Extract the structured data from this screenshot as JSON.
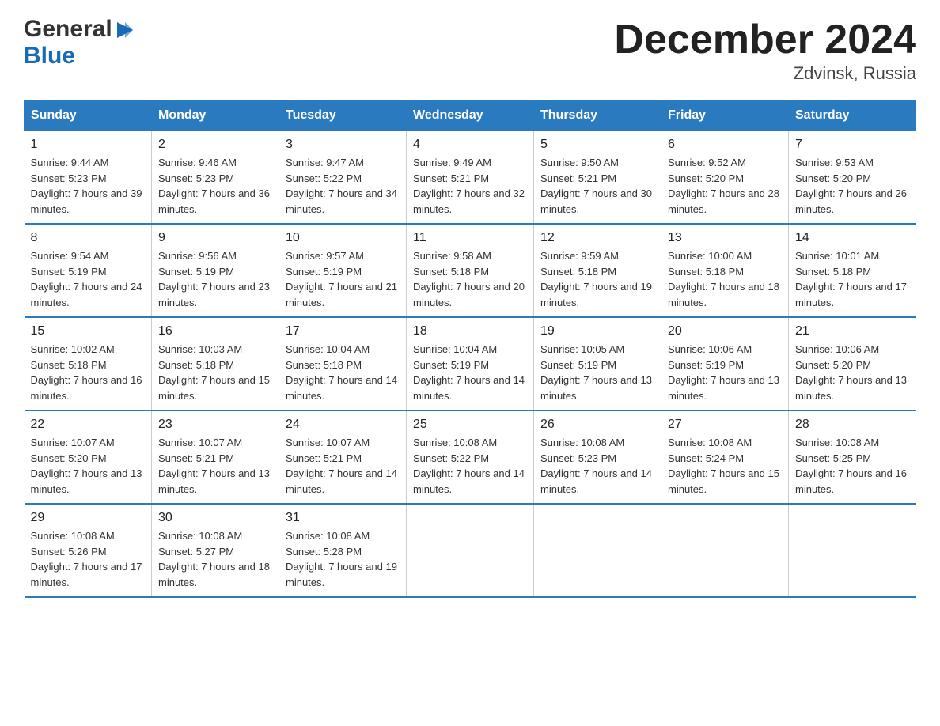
{
  "header": {
    "title": "December 2024",
    "subtitle": "Zdvinsk, Russia",
    "logo_general": "General",
    "logo_blue": "Blue"
  },
  "days_of_week": [
    "Sunday",
    "Monday",
    "Tuesday",
    "Wednesday",
    "Thursday",
    "Friday",
    "Saturday"
  ],
  "weeks": [
    [
      {
        "day": "1",
        "sunrise": "9:44 AM",
        "sunset": "5:23 PM",
        "daylight": "7 hours and 39 minutes."
      },
      {
        "day": "2",
        "sunrise": "9:46 AM",
        "sunset": "5:23 PM",
        "daylight": "7 hours and 36 minutes."
      },
      {
        "day": "3",
        "sunrise": "9:47 AM",
        "sunset": "5:22 PM",
        "daylight": "7 hours and 34 minutes."
      },
      {
        "day": "4",
        "sunrise": "9:49 AM",
        "sunset": "5:21 PM",
        "daylight": "7 hours and 32 minutes."
      },
      {
        "day": "5",
        "sunrise": "9:50 AM",
        "sunset": "5:21 PM",
        "daylight": "7 hours and 30 minutes."
      },
      {
        "day": "6",
        "sunrise": "9:52 AM",
        "sunset": "5:20 PM",
        "daylight": "7 hours and 28 minutes."
      },
      {
        "day": "7",
        "sunrise": "9:53 AM",
        "sunset": "5:20 PM",
        "daylight": "7 hours and 26 minutes."
      }
    ],
    [
      {
        "day": "8",
        "sunrise": "9:54 AM",
        "sunset": "5:19 PM",
        "daylight": "7 hours and 24 minutes."
      },
      {
        "day": "9",
        "sunrise": "9:56 AM",
        "sunset": "5:19 PM",
        "daylight": "7 hours and 23 minutes."
      },
      {
        "day": "10",
        "sunrise": "9:57 AM",
        "sunset": "5:19 PM",
        "daylight": "7 hours and 21 minutes."
      },
      {
        "day": "11",
        "sunrise": "9:58 AM",
        "sunset": "5:18 PM",
        "daylight": "7 hours and 20 minutes."
      },
      {
        "day": "12",
        "sunrise": "9:59 AM",
        "sunset": "5:18 PM",
        "daylight": "7 hours and 19 minutes."
      },
      {
        "day": "13",
        "sunrise": "10:00 AM",
        "sunset": "5:18 PM",
        "daylight": "7 hours and 18 minutes."
      },
      {
        "day": "14",
        "sunrise": "10:01 AM",
        "sunset": "5:18 PM",
        "daylight": "7 hours and 17 minutes."
      }
    ],
    [
      {
        "day": "15",
        "sunrise": "10:02 AM",
        "sunset": "5:18 PM",
        "daylight": "7 hours and 16 minutes."
      },
      {
        "day": "16",
        "sunrise": "10:03 AM",
        "sunset": "5:18 PM",
        "daylight": "7 hours and 15 minutes."
      },
      {
        "day": "17",
        "sunrise": "10:04 AM",
        "sunset": "5:18 PM",
        "daylight": "7 hours and 14 minutes."
      },
      {
        "day": "18",
        "sunrise": "10:04 AM",
        "sunset": "5:19 PM",
        "daylight": "7 hours and 14 minutes."
      },
      {
        "day": "19",
        "sunrise": "10:05 AM",
        "sunset": "5:19 PM",
        "daylight": "7 hours and 13 minutes."
      },
      {
        "day": "20",
        "sunrise": "10:06 AM",
        "sunset": "5:19 PM",
        "daylight": "7 hours and 13 minutes."
      },
      {
        "day": "21",
        "sunrise": "10:06 AM",
        "sunset": "5:20 PM",
        "daylight": "7 hours and 13 minutes."
      }
    ],
    [
      {
        "day": "22",
        "sunrise": "10:07 AM",
        "sunset": "5:20 PM",
        "daylight": "7 hours and 13 minutes."
      },
      {
        "day": "23",
        "sunrise": "10:07 AM",
        "sunset": "5:21 PM",
        "daylight": "7 hours and 13 minutes."
      },
      {
        "day": "24",
        "sunrise": "10:07 AM",
        "sunset": "5:21 PM",
        "daylight": "7 hours and 14 minutes."
      },
      {
        "day": "25",
        "sunrise": "10:08 AM",
        "sunset": "5:22 PM",
        "daylight": "7 hours and 14 minutes."
      },
      {
        "day": "26",
        "sunrise": "10:08 AM",
        "sunset": "5:23 PM",
        "daylight": "7 hours and 14 minutes."
      },
      {
        "day": "27",
        "sunrise": "10:08 AM",
        "sunset": "5:24 PM",
        "daylight": "7 hours and 15 minutes."
      },
      {
        "day": "28",
        "sunrise": "10:08 AM",
        "sunset": "5:25 PM",
        "daylight": "7 hours and 16 minutes."
      }
    ],
    [
      {
        "day": "29",
        "sunrise": "10:08 AM",
        "sunset": "5:26 PM",
        "daylight": "7 hours and 17 minutes."
      },
      {
        "day": "30",
        "sunrise": "10:08 AM",
        "sunset": "5:27 PM",
        "daylight": "7 hours and 18 minutes."
      },
      {
        "day": "31",
        "sunrise": "10:08 AM",
        "sunset": "5:28 PM",
        "daylight": "7 hours and 19 minutes."
      },
      null,
      null,
      null,
      null
    ]
  ],
  "labels": {
    "sunrise_prefix": "Sunrise: ",
    "sunset_prefix": "Sunset: ",
    "daylight_prefix": "Daylight: "
  }
}
